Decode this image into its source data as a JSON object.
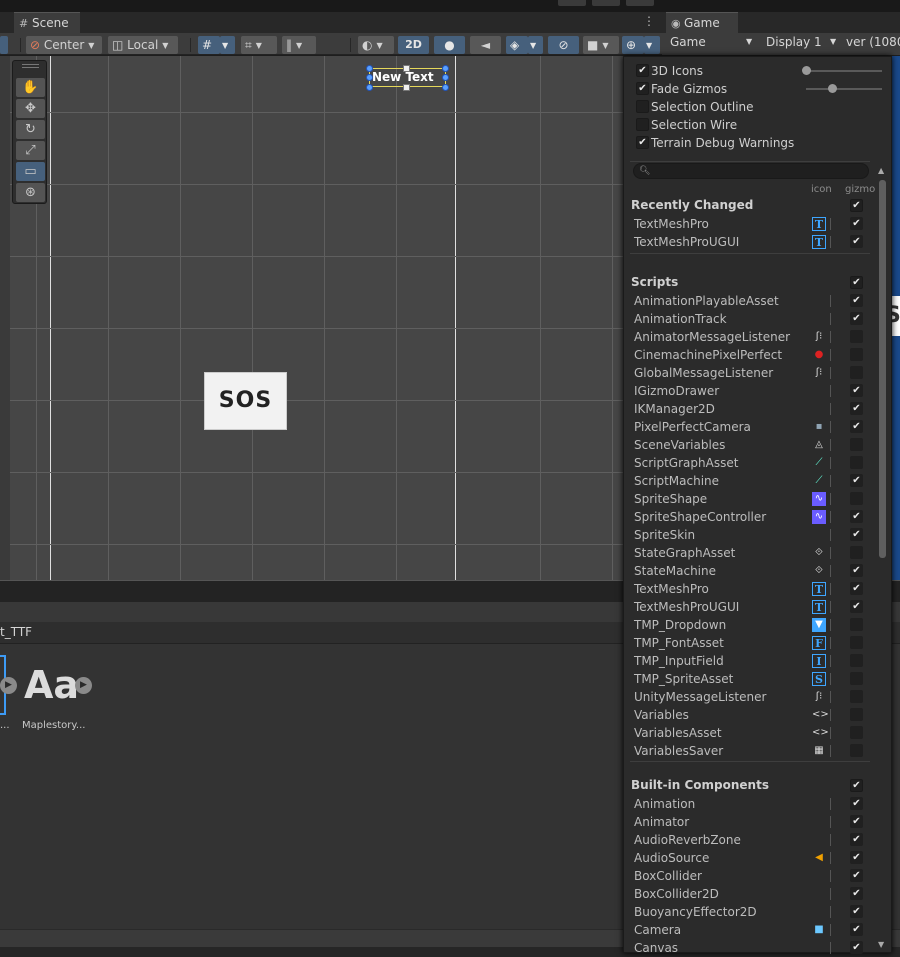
{
  "tabs": {
    "scene": "Scene",
    "game": "Game"
  },
  "scene_toolbar": {
    "pivot": "Center",
    "space": "Local",
    "mode_2d": "2D"
  },
  "game_bar": {
    "view": "Game",
    "display": "Display 1",
    "aspect": "ver (1080"
  },
  "scene": {
    "text_object": "New Text",
    "sprite_text": "SOS"
  },
  "project": {
    "folder_title": "t_TTF",
    "asset_glyph": "Aa",
    "asset_label": "Maplestory...",
    "asset_label_prev": "..."
  },
  "gizmos": {
    "options": [
      {
        "label": "3D Icons",
        "checked": true
      },
      {
        "label": "Fade Gizmos",
        "checked": true
      },
      {
        "label": "Selection Outline",
        "checked": false
      },
      {
        "label": "Selection Wire",
        "checked": false
      },
      {
        "label": "Terrain Debug Warnings",
        "checked": true
      }
    ],
    "col_icon": "icon",
    "col_gizmo": "gizmo",
    "recently_changed_title": "Recently Changed",
    "recently_changed": [
      {
        "name": "TextMeshPro",
        "icon": "T",
        "gizmo": true
      },
      {
        "name": "TextMeshProUGUI",
        "icon": "T",
        "gizmo": true
      }
    ],
    "scripts_title": "Scripts",
    "scripts": [
      {
        "name": "AnimationPlayableAsset",
        "icon": "",
        "gizmo": true
      },
      {
        "name": "AnimationTrack",
        "icon": "",
        "gizmo": true
      },
      {
        "name": "AnimatorMessageListener",
        "icon": "ear",
        "gizmo": false
      },
      {
        "name": "CinemachinePixelPerfect",
        "icon": "cine",
        "gizmo": false
      },
      {
        "name": "GlobalMessageListener",
        "icon": "ear",
        "gizmo": false
      },
      {
        "name": "IGizmoDrawer",
        "icon": "",
        "gizmo": true
      },
      {
        "name": "IKManager2D",
        "icon": "",
        "gizmo": true
      },
      {
        "name": "PixelPerfectCamera",
        "icon": "cam",
        "gizmo": true
      },
      {
        "name": "SceneVariables",
        "icon": "scene",
        "gizmo": false
      },
      {
        "name": "ScriptGraphAsset",
        "icon": "graph",
        "gizmo": false
      },
      {
        "name": "ScriptMachine",
        "icon": "graph",
        "gizmo": true
      },
      {
        "name": "SpriteShape",
        "icon": "shape",
        "gizmo": false
      },
      {
        "name": "SpriteShapeController",
        "icon": "shape",
        "gizmo": true
      },
      {
        "name": "SpriteSkin",
        "icon": "",
        "gizmo": true
      },
      {
        "name": "StateGraphAsset",
        "icon": "state",
        "gizmo": false
      },
      {
        "name": "StateMachine",
        "icon": "state",
        "gizmo": true
      },
      {
        "name": "TextMeshPro",
        "icon": "T",
        "gizmo": true
      },
      {
        "name": "TextMeshProUGUI",
        "icon": "T",
        "gizmo": true
      },
      {
        "name": "TMP_Dropdown",
        "icon": "drop",
        "gizmo": false
      },
      {
        "name": "TMP_FontAsset",
        "icon": "F",
        "gizmo": false
      },
      {
        "name": "TMP_InputField",
        "icon": "I",
        "gizmo": false
      },
      {
        "name": "TMP_SpriteAsset",
        "icon": "S",
        "gizmo": false
      },
      {
        "name": "UnityMessageListener",
        "icon": "ear",
        "gizmo": false
      },
      {
        "name": "Variables",
        "icon": "var",
        "gizmo": false
      },
      {
        "name": "VariablesAsset",
        "icon": "var",
        "gizmo": false
      },
      {
        "name": "VariablesSaver",
        "icon": "saver",
        "gizmo": false
      }
    ],
    "builtin_title": "Built-in Components",
    "builtin": [
      {
        "name": "Animation",
        "icon": "",
        "gizmo": true
      },
      {
        "name": "Animator",
        "icon": "",
        "gizmo": true
      },
      {
        "name": "AudioReverbZone",
        "icon": "",
        "gizmo": true
      },
      {
        "name": "AudioSource",
        "icon": "audio",
        "gizmo": true
      },
      {
        "name": "BoxCollider",
        "icon": "",
        "gizmo": true
      },
      {
        "name": "BoxCollider2D",
        "icon": "",
        "gizmo": true
      },
      {
        "name": "BuoyancyEffector2D",
        "icon": "",
        "gizmo": true
      },
      {
        "name": "Camera",
        "icon": "camera",
        "gizmo": true
      },
      {
        "name": "Canvas",
        "icon": "",
        "gizmo": true
      }
    ]
  },
  "colors": {
    "accent_blue": "#3ea6ff",
    "game_bg": "#1a4a8c",
    "selection_yellow": "#e5d85b"
  }
}
